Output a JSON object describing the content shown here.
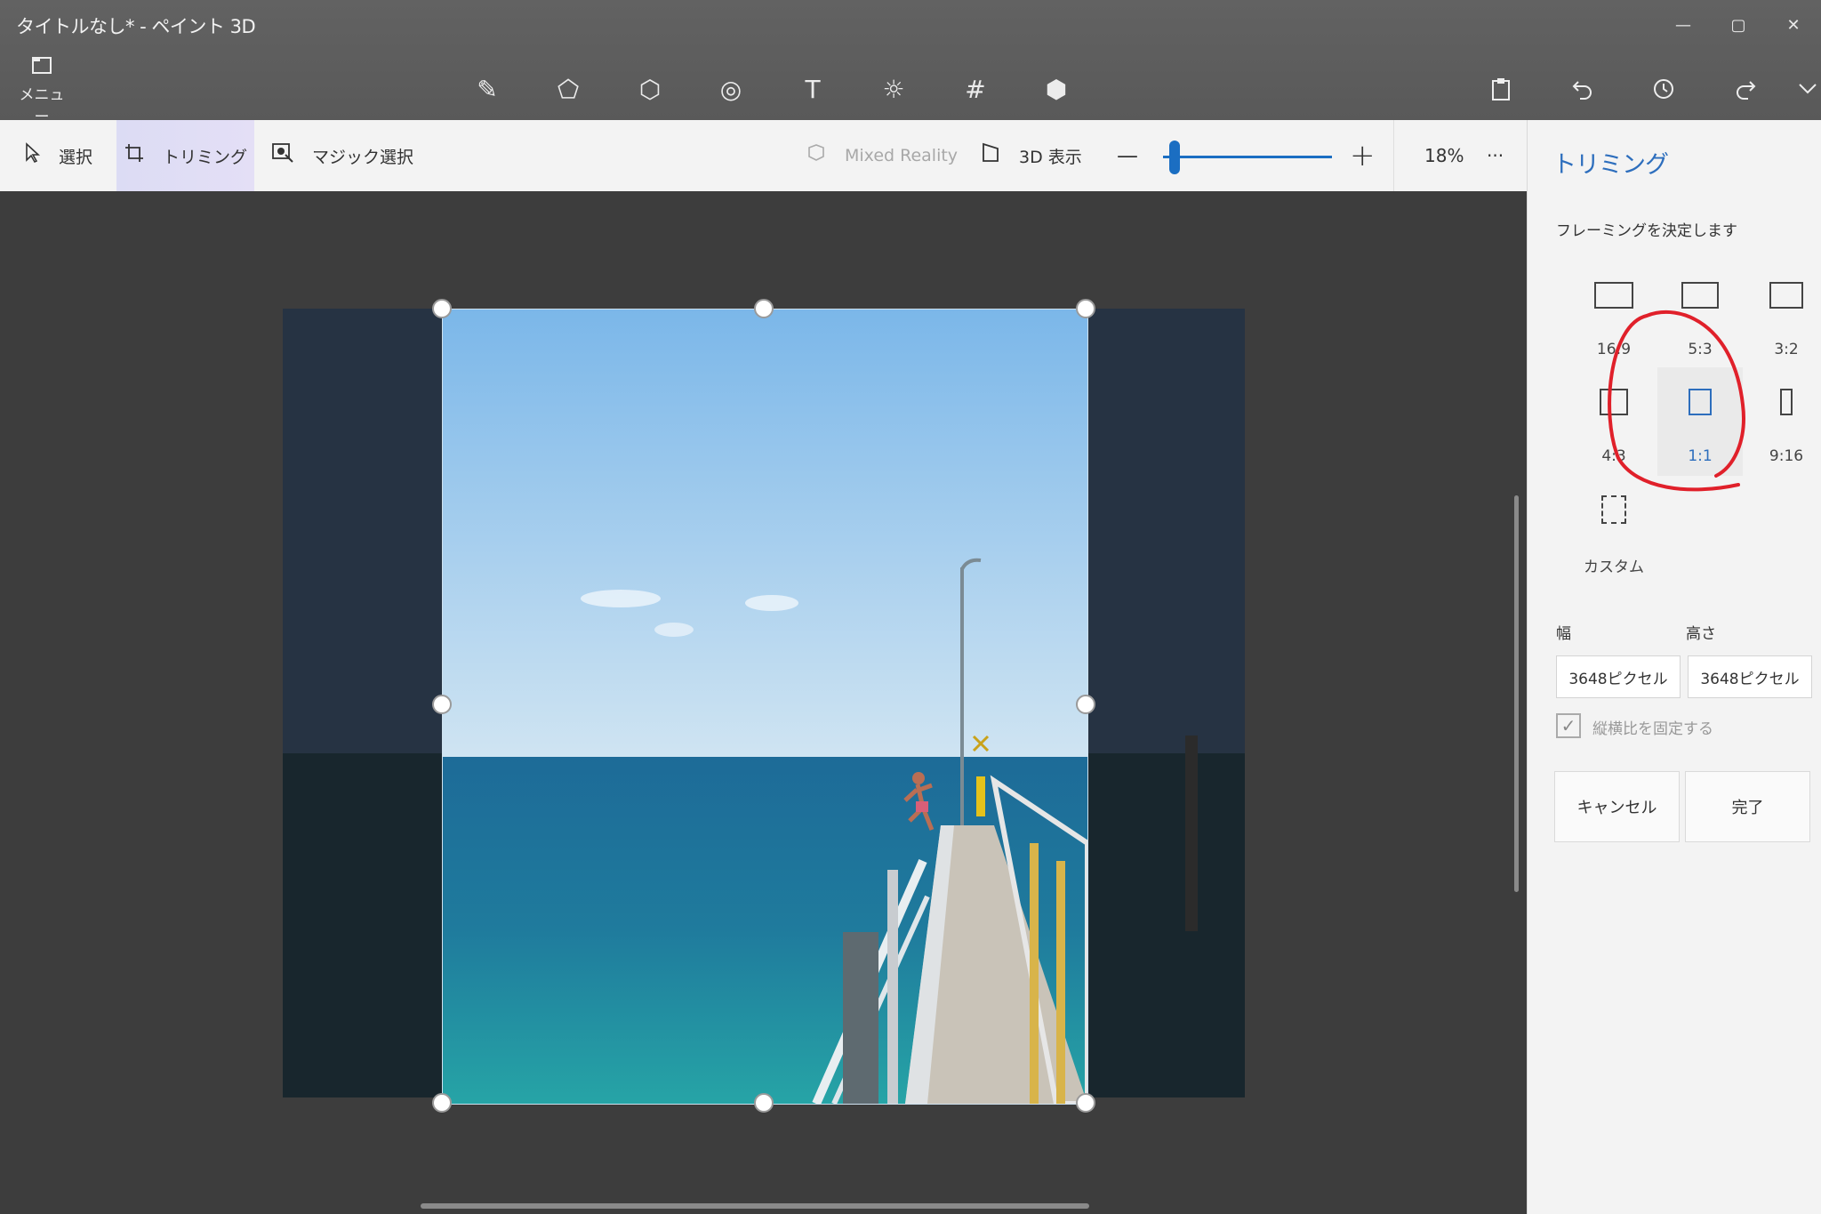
{
  "window": {
    "title": "タイトルなし* - ペイント 3D",
    "controls": [
      "—",
      "▢",
      "✕"
    ]
  },
  "menu": {
    "label": "メニュー"
  },
  "tools": [
    {
      "name": "brushes-icon",
      "glyph": "✎"
    },
    {
      "name": "2d-shapes-icon",
      "glyph": "⬠"
    },
    {
      "name": "3d-shapes-icon",
      "glyph": "⬡"
    },
    {
      "name": "stickers-icon",
      "glyph": "◎"
    },
    {
      "name": "text-icon",
      "glyph": "T"
    },
    {
      "name": "effects-icon",
      "glyph": "☼"
    },
    {
      "name": "canvas-icon",
      "glyph": "#"
    },
    {
      "name": "3d-library-icon",
      "glyph": "⬢"
    }
  ],
  "right_tools": [
    "paste-icon",
    "undo-icon",
    "history-icon",
    "redo-icon",
    "expand-icon"
  ],
  "toolbar": {
    "select": "選択",
    "crop": "トリミング",
    "magic_select": "マジック選択",
    "mixed_reality": "Mixed Reality",
    "view_3d": "3D 表示",
    "zoom_minus": "—",
    "zoom_plus": "+",
    "zoom_value": "18%",
    "more": "···"
  },
  "panel": {
    "title": "トリミング",
    "subtitle": "フレーミングを決定します",
    "ratios": [
      {
        "label": "16:9"
      },
      {
        "label": "5:3"
      },
      {
        "label": "3:2"
      },
      {
        "label": "4:3"
      },
      {
        "label": "1:1"
      },
      {
        "label": "9:16"
      },
      {
        "label": "カスタム"
      }
    ],
    "selected_ratio": "1:1",
    "width_label": "幅",
    "height_label": "高さ",
    "width_value": "3648ピクセル",
    "height_value": "3648ピクセル",
    "lock_ratio": "縦横比を固定する",
    "cancel": "キャンセル",
    "done": "完了"
  },
  "colors": {
    "accent": "#2d6ebd",
    "annotation": "#e0202a"
  }
}
